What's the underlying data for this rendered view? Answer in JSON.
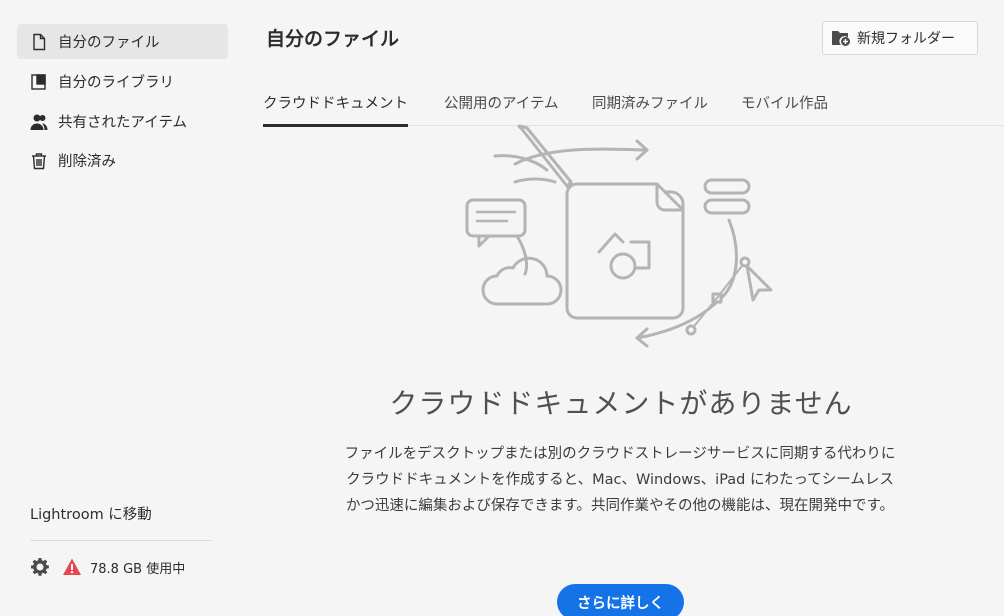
{
  "sidebar": {
    "items": [
      {
        "label": "自分のファイル",
        "icon": "file-icon",
        "active": true
      },
      {
        "label": "自分のライブラリ",
        "icon": "library-icon",
        "active": false
      },
      {
        "label": "共有されたアイテム",
        "icon": "shared-users-icon",
        "active": false
      },
      {
        "label": "削除済み",
        "icon": "trash-icon",
        "active": false
      }
    ],
    "lightroom_link": "Lightroom に移動",
    "storage_text": "78.8 GB 使用中",
    "warning_color": "#e34850"
  },
  "header": {
    "title": "自分のファイル",
    "new_folder_label": "新規フォルダー"
  },
  "tabs": [
    {
      "label": "クラウドドキュメント",
      "active": true
    },
    {
      "label": "公開用のアイテム",
      "active": false
    },
    {
      "label": "同期済みファイル",
      "active": false
    },
    {
      "label": "モバイル作品",
      "active": false
    }
  ],
  "empty_state": {
    "title": "クラウドドキュメントがありません",
    "description": "ファイルをデスクトップまたは別のクラウドストレージサービスに同期する代わりにクラウドドキュメントを作成すると、Mac、Windows、iPad にわたってシームレスかつ迅速に編集および保存できます。共同作業やその他の機能は、現在開発中です。",
    "button_label": "さらに詳しく",
    "accent_color": "#1473e6"
  }
}
